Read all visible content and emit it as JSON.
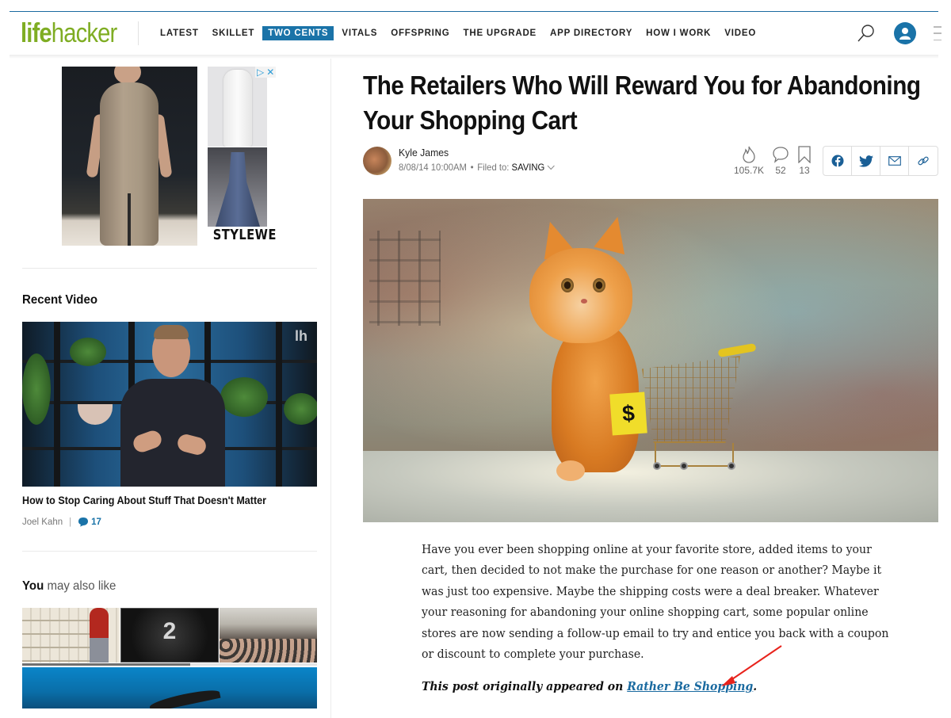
{
  "brand": {
    "logo_bold": "life",
    "logo_light": "hacker",
    "accent_color": "#1a73a8",
    "logo_color": "#7fad23"
  },
  "nav": {
    "items": [
      {
        "label": "LATEST",
        "active": false
      },
      {
        "label": "SKILLET",
        "active": false
      },
      {
        "label": "TWO CENTS",
        "active": true
      },
      {
        "label": "VITALS",
        "active": false
      },
      {
        "label": "OFFSPRING",
        "active": false
      },
      {
        "label": "THE UPGRADE",
        "active": false
      },
      {
        "label": "APP DIRECTORY",
        "active": false
      },
      {
        "label": "HOW I WORK",
        "active": false
      },
      {
        "label": "VIDEO",
        "active": false
      }
    ],
    "icons": [
      "search-icon",
      "user-icon",
      "menu-icon"
    ]
  },
  "sidebar": {
    "ad": {
      "brand": "STYLEWE",
      "adchoices_glyph": "▷",
      "close_glyph": "✕"
    },
    "recent_video": {
      "heading": "Recent Video",
      "watermark": "lh",
      "title": "How to Stop Caring About Stuff That Doesn't Matter",
      "author": "Joel Kahn",
      "separator": "|",
      "comment_count": "17"
    },
    "you_may_also_like": {
      "heading_bold": "You",
      "heading_rest": " may also like",
      "tiles": [
        {
          "label": ""
        },
        {
          "label": "2"
        },
        {
          "label": ""
        }
      ],
      "carousel_progress": 0.57
    }
  },
  "article": {
    "title": "The Retailers Who Will Reward You for Abandoning Your Shopping Cart",
    "author": "Kyle James",
    "date": "8/08/14 10:00AM",
    "bullet": "•",
    "filed_to_label": "Filed to:",
    "category": "SAVING",
    "stats": {
      "views": "105.7K",
      "comments": "52",
      "bookmarks": "13"
    },
    "share_buttons": [
      "facebook-icon",
      "twitter-icon",
      "email-icon",
      "link-icon"
    ],
    "hero_caption_symbol": "$",
    "body": "Have you ever been shopping online at your favorite store, added items to your cart, then decided to not make the purchase for one reason or another? Maybe it was just too expensive. Maybe the shipping costs were a deal breaker. Whatever your reasoning for abandoning your online shopping cart, some popular online stores are now sending a follow-up email to try and entice you back with a coupon or discount to complete your purchase.",
    "source_prefix": "This post originally appeared on ",
    "source_link": "Rather Be Shopping",
    "source_suffix": "."
  },
  "annotation": {
    "arrow_color": "#e8231c"
  }
}
